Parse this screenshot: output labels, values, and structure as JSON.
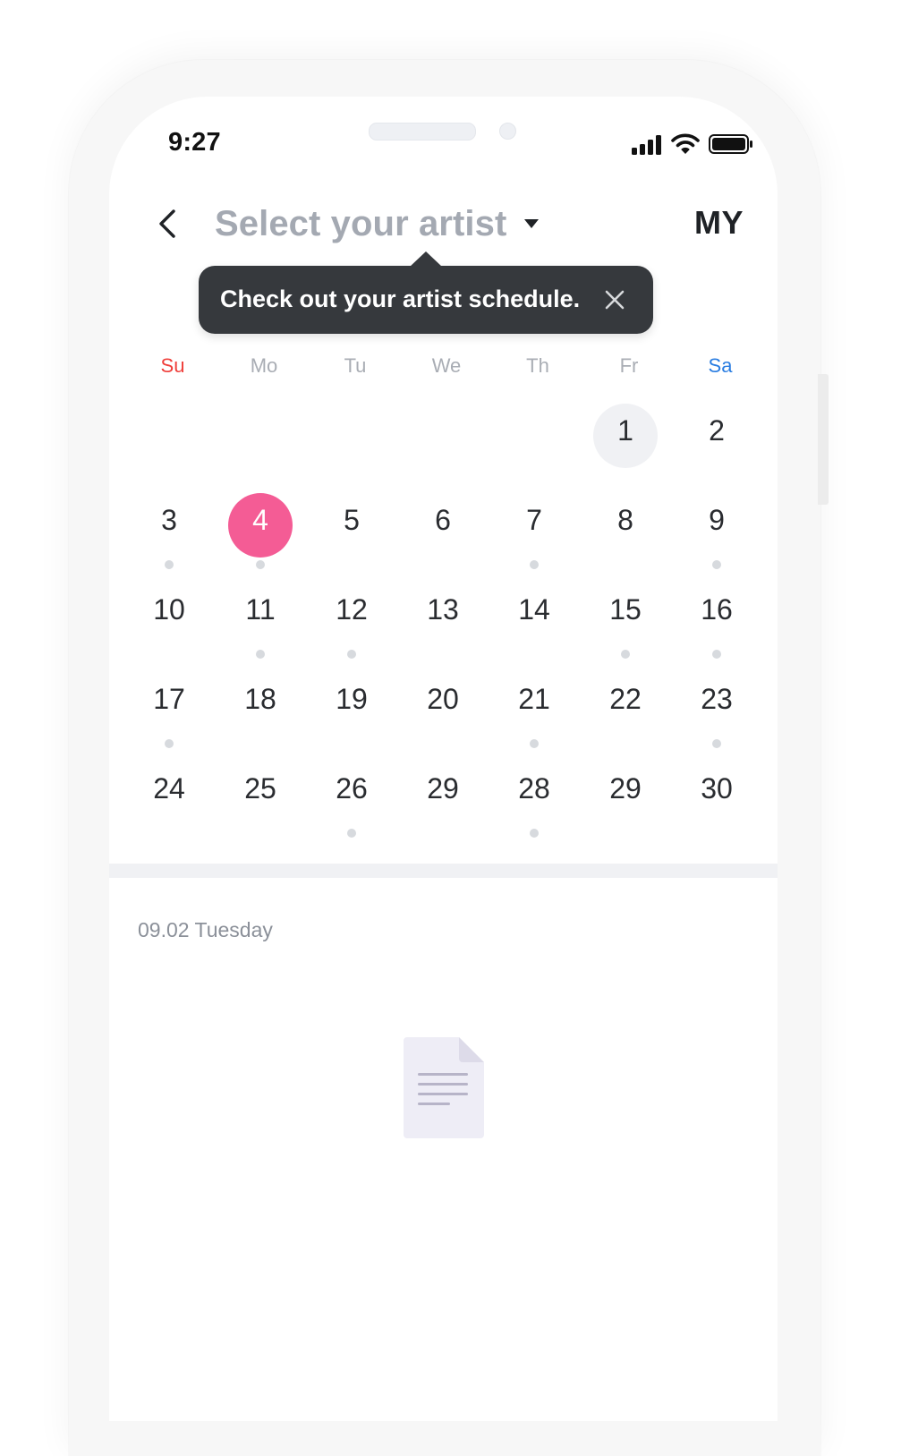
{
  "status_bar": {
    "time": "9:27"
  },
  "header": {
    "title": "Select your artist",
    "my_label": "MY"
  },
  "tooltip": {
    "text": "Check out your artist schedule."
  },
  "calendar": {
    "weekdays": [
      "Su",
      "Mo",
      "Tu",
      "We",
      "Th",
      "Fr",
      "Sa"
    ],
    "weeks": [
      [
        {
          "day": "",
          "dot": false
        },
        {
          "day": "",
          "dot": false
        },
        {
          "day": "",
          "dot": false
        },
        {
          "day": "",
          "dot": false
        },
        {
          "day": "",
          "dot": false
        },
        {
          "day": "1",
          "dot": false,
          "state": "today"
        },
        {
          "day": "2",
          "dot": false
        }
      ],
      [
        {
          "day": "3",
          "dot": true
        },
        {
          "day": "4",
          "dot": true,
          "state": "selected"
        },
        {
          "day": "5",
          "dot": false
        },
        {
          "day": "6",
          "dot": false
        },
        {
          "day": "7",
          "dot": true
        },
        {
          "day": "8",
          "dot": false
        },
        {
          "day": "9",
          "dot": true
        }
      ],
      [
        {
          "day": "10",
          "dot": false
        },
        {
          "day": "11",
          "dot": true
        },
        {
          "day": "12",
          "dot": true
        },
        {
          "day": "13",
          "dot": false
        },
        {
          "day": "14",
          "dot": false
        },
        {
          "day": "15",
          "dot": true
        },
        {
          "day": "16",
          "dot": true
        }
      ],
      [
        {
          "day": "17",
          "dot": true
        },
        {
          "day": "18",
          "dot": false
        },
        {
          "day": "19",
          "dot": false
        },
        {
          "day": "20",
          "dot": false
        },
        {
          "day": "21",
          "dot": true
        },
        {
          "day": "22",
          "dot": false
        },
        {
          "day": "23",
          "dot": true
        }
      ],
      [
        {
          "day": "24",
          "dot": false
        },
        {
          "day": "25",
          "dot": false
        },
        {
          "day": "26",
          "dot": true
        },
        {
          "day": "29",
          "dot": false
        },
        {
          "day": "28",
          "dot": true
        },
        {
          "day": "29",
          "dot": false
        },
        {
          "day": "30",
          "dot": false
        }
      ]
    ],
    "colors": {
      "selected": "#f45c95",
      "today": "#f0f1f4",
      "sunday": "#ef3e3a",
      "saturday": "#2a7de1",
      "dot": "#d7dade"
    }
  },
  "schedule": {
    "date_heading": "09.02 Tuesday",
    "empty_icon": "document-icon"
  }
}
